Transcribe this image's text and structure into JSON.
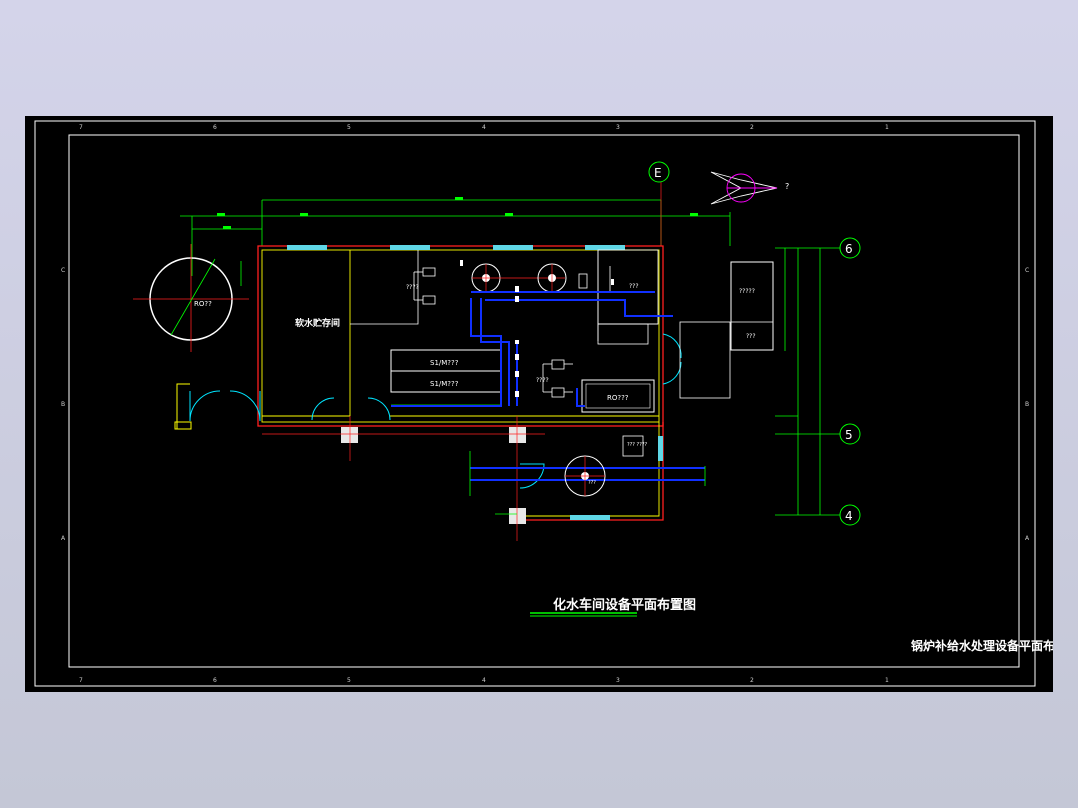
{
  "viewport": {
    "background": "#000000"
  },
  "colors": {
    "wall": "#ff2020",
    "inner": "#ffff00",
    "dim": "#00ff00",
    "pipe": "#1030ff",
    "equip": "#ffffff",
    "door": "#00e5ff",
    "grid_axis": "#ff3030",
    "magenta": "#ff00ff",
    "window": "#5fd7e6"
  },
  "border": {
    "top_numbers": [
      "7",
      "6",
      "5",
      "4",
      "3",
      "2",
      "1"
    ],
    "bottom_numbers": [
      "7",
      "6",
      "5",
      "4",
      "3",
      "2",
      "1"
    ],
    "side_letters": [
      "C",
      "B",
      "A"
    ]
  },
  "grid_bubbles": {
    "E": "E",
    "6": "6",
    "5": "5",
    "4": "4"
  },
  "labels": {
    "tank_left": "RO??",
    "storage_room": "软水贮存间",
    "pump_group_top": "????",
    "filter_top": "???",
    "box_small": "???",
    "softener_1": "S1/M???",
    "softener_2": "S1/M???",
    "pump_group_mid": "????",
    "ro_unit": "RO???",
    "lower_box": "???\n????",
    "lower_pump": "???",
    "side_cabinet": "?????",
    "side_cabinet_2": "???",
    "north_label": "?"
  },
  "titles": {
    "main": "化水车间设备平面布置图",
    "corner": "锅炉补给水处理设备平面布置图"
  }
}
